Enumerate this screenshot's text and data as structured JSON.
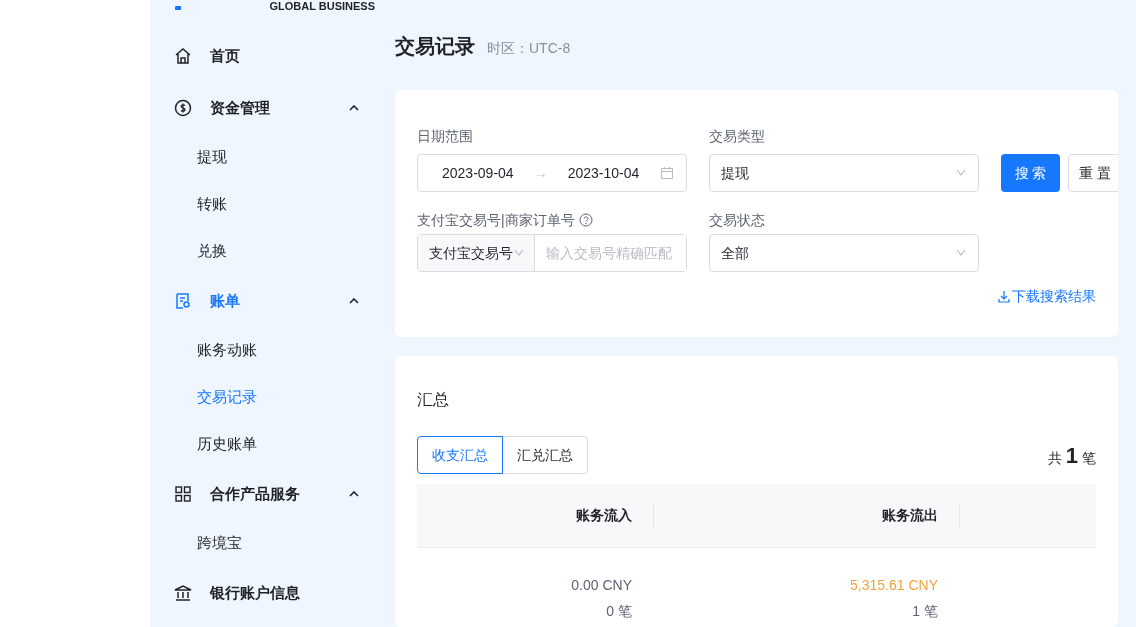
{
  "logo": {
    "subtitle": "GLOBAL BUSINESS"
  },
  "sidebar": {
    "items": [
      {
        "label": "首页",
        "selected": false
      },
      {
        "label": "资金管理",
        "selected": false,
        "expanded": true,
        "children": [
          {
            "label": "提现",
            "selected": false
          },
          {
            "label": "转账",
            "selected": false
          },
          {
            "label": "兑换",
            "selected": false
          }
        ]
      },
      {
        "label": "账单",
        "selected": true,
        "expanded": true,
        "children": [
          {
            "label": "账务动账",
            "selected": false
          },
          {
            "label": "交易记录",
            "selected": true
          },
          {
            "label": "历史账单",
            "selected": false
          }
        ]
      },
      {
        "label": "合作产品服务",
        "selected": false,
        "expanded": true,
        "children": [
          {
            "label": "跨境宝",
            "selected": false
          }
        ]
      },
      {
        "label": "银行账户信息",
        "selected": false
      }
    ]
  },
  "page": {
    "title": "交易记录",
    "timezone": "时区：UTC-8"
  },
  "filters": {
    "date_range": {
      "label": "日期范围",
      "start": "2023-09-04",
      "separator": "→",
      "end": "2023-10-04"
    },
    "transaction_type": {
      "label": "交易类型",
      "value": "提现"
    },
    "search_button": "搜 索",
    "reset_button": "重 置",
    "transaction_no": {
      "label": "支付宝交易号|商家订单号",
      "type_value": "支付宝交易号",
      "placeholder": "输入交易号精确匹配"
    },
    "transaction_status": {
      "label": "交易状态",
      "value": "全部"
    },
    "download_link": "下载搜索结果"
  },
  "summary": {
    "title": "汇总",
    "tabs": [
      {
        "label": "收支汇总",
        "selected": true
      },
      {
        "label": "汇兑汇总",
        "selected": false
      }
    ],
    "total": "共 **1** 笔",
    "table": {
      "columns": [
        "账务流入",
        "账务流出"
      ],
      "rows": [
        {
          "inflow": "0.00 CNY",
          "inflow_count": "0 笔",
          "outflow": "5,315.61 CNY",
          "outflow_count": "1 笔"
        }
      ]
    }
  }
}
